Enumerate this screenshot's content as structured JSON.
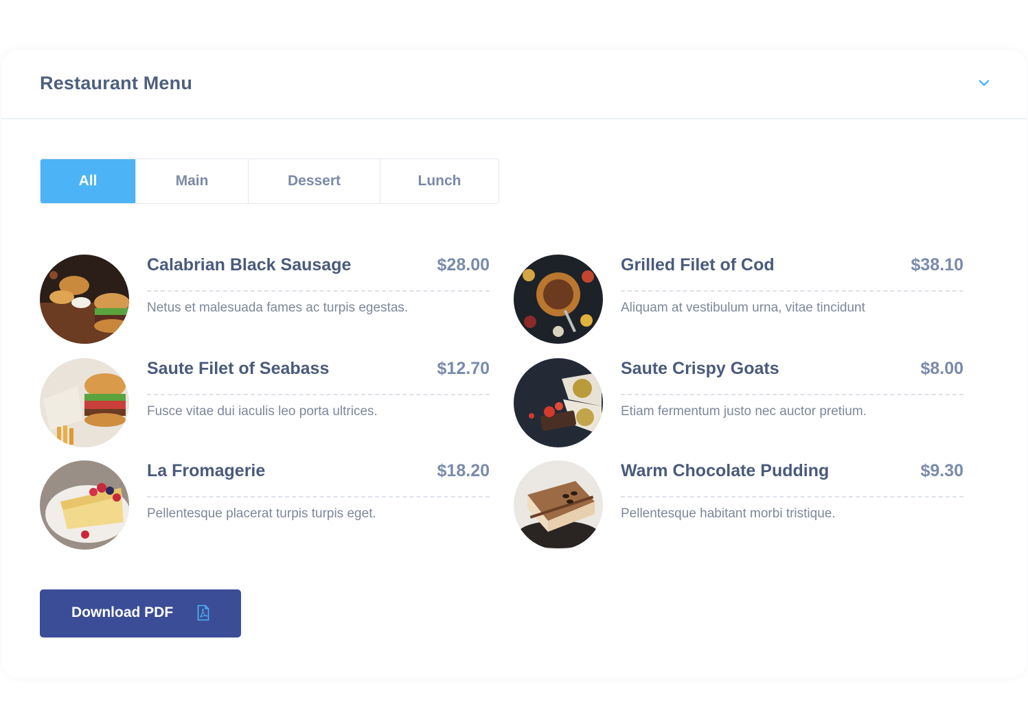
{
  "header": {
    "title": "Restaurant Menu",
    "toggle_icon": "chevron-down-icon"
  },
  "tabs": [
    {
      "label": "All",
      "active": true
    },
    {
      "label": "Main",
      "active": false
    },
    {
      "label": "Dessert",
      "active": false
    },
    {
      "label": "Lunch",
      "active": false
    }
  ],
  "menu_items": [
    {
      "name": "Calabrian Black Sausage",
      "price": "$28.00",
      "description": "Netus et malesuada fames ac turpis egestas.",
      "image": "burger-platter-photo"
    },
    {
      "name": "Grilled Filet of Cod",
      "price": "$38.10",
      "description": "Aliquam at vestibulum urna, vitae tincidunt",
      "image": "grilled-dish-photo"
    },
    {
      "name": "Saute Filet of Seabass",
      "price": "$12.70",
      "description": "Fusce vitae dui iaculis leo porta ultrices.",
      "image": "burger-wrap-photo"
    },
    {
      "name": "Saute Crispy Goats",
      "price": "$8.00",
      "description": "Etiam fermentum justo nec auctor pretium.",
      "image": "wraps-photo"
    },
    {
      "name": "La Fromagerie",
      "price": "$18.20",
      "description": "Pellentesque placerat turpis turpis eget.",
      "image": "cheesecake-photo"
    },
    {
      "name": "Warm Chocolate Pudding",
      "price": "$9.30",
      "description": "Pellentesque habitant morbi tristique.",
      "image": "tiramisu-photo"
    }
  ],
  "download": {
    "label": "Download PDF",
    "icon": "pdf-file-icon"
  },
  "colors": {
    "accent": "#4db3f7",
    "button": "#3b4d96",
    "title": "#4e5f7e",
    "price": "#7a8aab",
    "text": "#7d879a"
  }
}
